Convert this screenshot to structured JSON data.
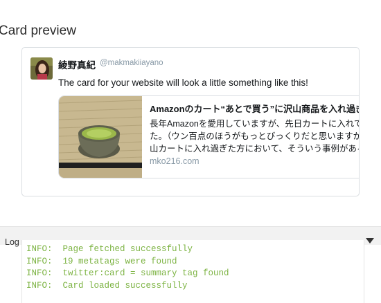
{
  "card_preview": {
    "title": "Card preview",
    "tweet": {
      "display_name": "綾野真紀",
      "handle": "@makmakiiayano",
      "text": "The card for your website will look a little something like this!",
      "avatar_icon": "avatar-photo-icon",
      "link_card": {
        "thumbnail_icon": "matcha-tea-bowl-image-icon",
        "title": "Amazonのカート“あとで買う”に沢山商品を入れ過ぎて",
        "description_lines": [
          "長年Amazonを愛用していますが、先日カートに入れてい",
          "た。（ウン百点のほうがもっとびっくりだと思いますが",
          "山カートに入れ過ぎた方において、そういう事例がある"
        ],
        "domain": "mko216.com"
      }
    }
  },
  "log": {
    "title": "Log",
    "toggle_icon": "triangle-down-icon",
    "lines": [
      "INFO:  Page fetched successfully",
      "INFO:  19 metatags were found",
      "INFO:  twitter:card = summary tag found",
      "INFO:  Card loaded successfully"
    ],
    "line_color": "#7cb342"
  },
  "colors": {
    "border": "#d9dde1",
    "muted_text": "#8899a6",
    "log_header_bg": "#f2f2f2"
  }
}
